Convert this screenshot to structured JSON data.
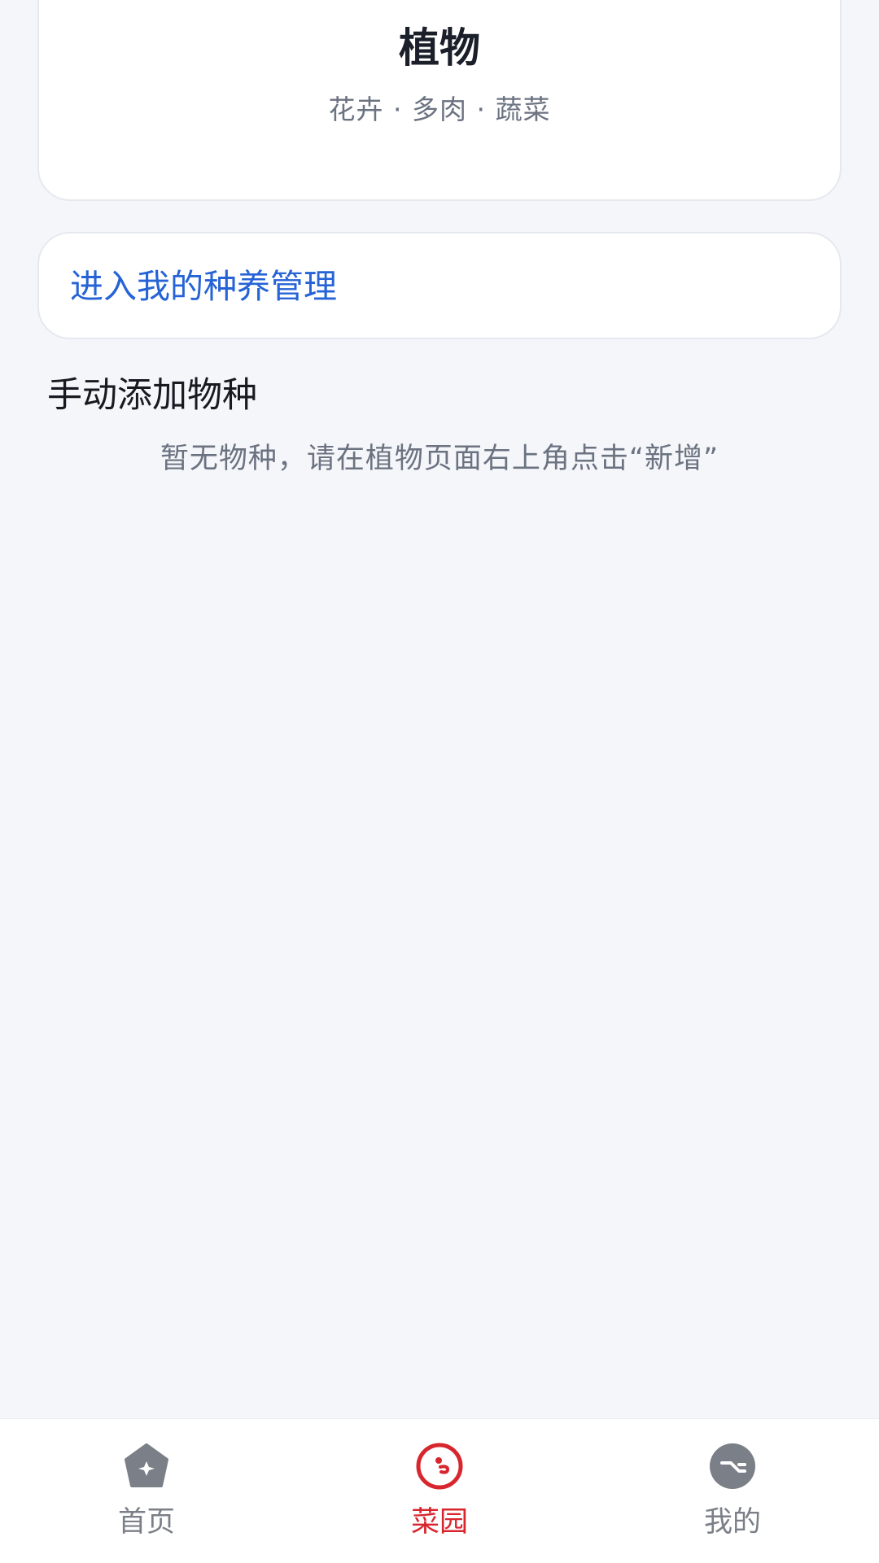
{
  "card": {
    "title": "植物",
    "subtitle": "花卉 · 多肉 · 蔬菜"
  },
  "manage_link": {
    "label": "进入我的种养管理"
  },
  "manual_add": {
    "title": "手动添加物种",
    "empty_text": "暂无物种，请在植物页面右上角点击“新增”"
  },
  "tabbar": {
    "items": [
      {
        "label": "首页",
        "icon": "home-icon",
        "active": false
      },
      {
        "label": "菜园",
        "icon": "garden-icon",
        "active": true
      },
      {
        "label": "我的",
        "icon": "profile-icon",
        "active": false
      }
    ]
  },
  "colors": {
    "accent_red": "#d8262e",
    "link_blue": "#2563d6",
    "inactive_gray": "#7b7f87",
    "background": "#f4f6fa"
  }
}
